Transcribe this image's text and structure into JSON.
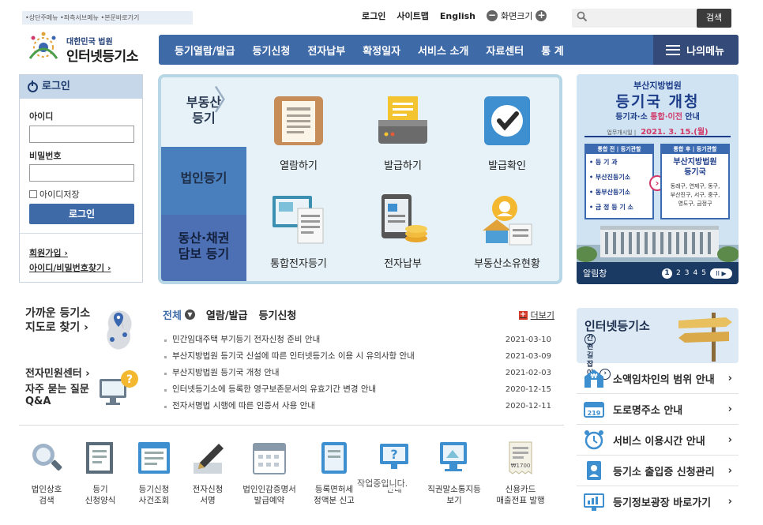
{
  "skip_nav": "•상단주메뉴 •좌측서브메뉴 •본문바로가기",
  "util": {
    "login": "로그인",
    "sitemap": "사이트맵",
    "english": "English",
    "zoom_label": "화면크기",
    "zoom_minus": "−",
    "zoom_plus": "+"
  },
  "search": {
    "placeholder": "",
    "button": "검색"
  },
  "logo": {
    "small": "대한민국 법원",
    "big": "인터넷등기소"
  },
  "gnb": {
    "items": [
      "등기열람/발급",
      "등기신청",
      "전자납부",
      "확정일자",
      "서비스 소개",
      "자료센터",
      "통 계"
    ],
    "mymenu": "나의메뉴"
  },
  "login": {
    "title": "로그인",
    "id_label": "아이디",
    "pw_label": "비밀번호",
    "save_id": "아이디저장",
    "button": "로그인",
    "join": "회원가입",
    "find": "아이디/비밀번호찾기"
  },
  "services": {
    "tabs": [
      "부동산\n등기",
      "법인등기",
      "동산·채권\n담보 등기"
    ],
    "items": [
      "열람하기",
      "발급하기",
      "발급확인",
      "통합전자등기",
      "전자납부",
      "부동산소유현황"
    ]
  },
  "banner": {
    "court": "부산지방법원",
    "headline": "등기국 개청",
    "sub_a": "등기과·소 ",
    "sub_b": "통합·이전",
    "sub_c": " 안내",
    "date_label": "업무개시일 |",
    "date": "2021. 3. 15.(월)",
    "left_head": "통합 전 | 등기관할",
    "left_rows": [
      "• 등 기 과",
      "• 부산진등기소",
      "• 동부산등기소",
      "• 금 정 등 기 소"
    ],
    "right_head": "통합 후 | 등기관할",
    "right_title": "부산지방법원\n등기국",
    "right_sub": "동래구, 연제구, 동구,\n부산진구, 서구, 중구,\n영도구, 금정구",
    "footer": "알림창",
    "pages": [
      "1",
      "2",
      "3",
      "4",
      "5"
    ],
    "ctl": "II ▶"
  },
  "left_info": {
    "near_line1": "가까운 등기소",
    "near_line2": "지도로 찾기 ›",
    "civil": "전자민원센터 ›",
    "faq_line1": "자주 묻는 질문",
    "faq_line2": "Q&A"
  },
  "notice": {
    "tabs": [
      "전체",
      "열람/발급",
      "등기신청"
    ],
    "more": "더보기",
    "items": [
      {
        "title": "민간임대주택 부기등기 전자신청 준비 안내",
        "date": "2021-03-10"
      },
      {
        "title": "부산지방법원 등기국 신설에 따른 인터넷등기소 이용 시 유의사항 안내",
        "date": "2021-03-09"
      },
      {
        "title": "부산지방법원 등기국 개청 안내",
        "date": "2021-02-03"
      },
      {
        "title": "인터넷등기소에 등록한 영구보존문서의 유효기간 변경 안내",
        "date": "2020-12-15"
      },
      {
        "title": "전자서명법 시행에 따른 인증서 사용 안내",
        "date": "2020-12-11"
      }
    ]
  },
  "guide": {
    "line1": "인터넷등기소",
    "line2": "간편길잡이"
  },
  "quick": [
    {
      "label": "소액임차인의 범위 안내"
    },
    {
      "label": "도로명주소 안내"
    },
    {
      "label": "서비스 이용시간 안내"
    },
    {
      "label": "등기소 출입증 신청관리"
    },
    {
      "label": "등기정보광장 바로가기"
    }
  ],
  "bottom": [
    {
      "l1": "법인상호",
      "l2": "검색"
    },
    {
      "l1": "등기",
      "l2": "신청양식"
    },
    {
      "l1": "등기신청",
      "l2": "사건조회"
    },
    {
      "l1": "전자신청",
      "l2": "서명"
    },
    {
      "l1": "법인인감증명서",
      "l2": "발급예약"
    },
    {
      "l1": "등록면허세",
      "l2": "정액분 신고"
    },
    {
      "l1": "",
      "l2": "안내"
    },
    {
      "l1": "직권말소통지등",
      "l2": "보기"
    },
    {
      "l1": "신용카드",
      "l2": "매출전표 발행"
    }
  ],
  "loading_text": "작업중입니다.",
  "colors": {
    "primary": "#3f6aa8",
    "navy": "#344b7a",
    "accent_red": "#d43b2a"
  }
}
